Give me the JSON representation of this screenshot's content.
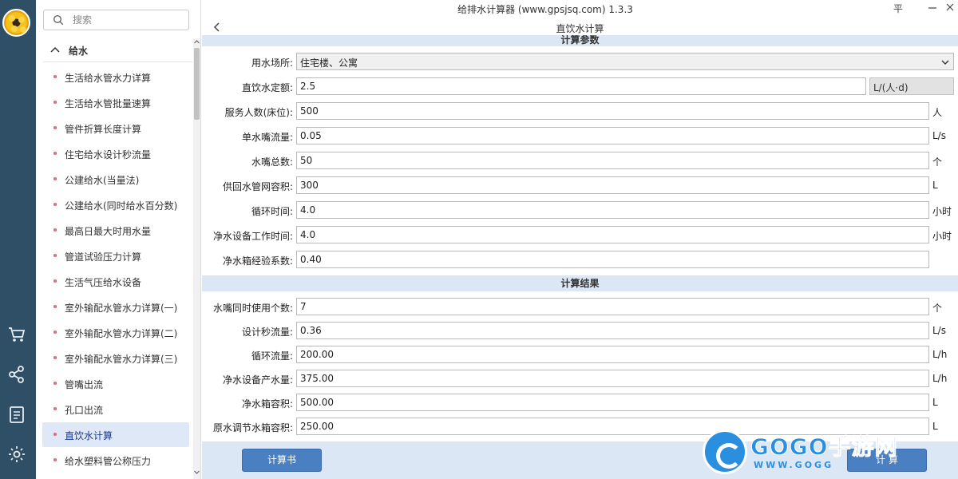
{
  "window": {
    "title": "给排水计算器 (www.gpsjsq.com) 1.3.3",
    "pin_glyph": "平"
  },
  "sidebar": {
    "search_placeholder": "搜索",
    "group_label": "给水",
    "items": [
      {
        "label": "生活给水管水力详算"
      },
      {
        "label": "生活给水管批量速算"
      },
      {
        "label": "管件折算长度计算"
      },
      {
        "label": "住宅给水设计秒流量"
      },
      {
        "label": "公建给水(当量法)"
      },
      {
        "label": "公建给水(同时给水百分数)"
      },
      {
        "label": "最高日最大时用水量"
      },
      {
        "label": "管道试验压力计算"
      },
      {
        "label": "生活气压给水设备"
      },
      {
        "label": "室外输配水管水力详算(一)"
      },
      {
        "label": "室外输配水管水力详算(二)"
      },
      {
        "label": "室外输配水管水力详算(三)"
      },
      {
        "label": "管嘴出流"
      },
      {
        "label": "孔口出流"
      },
      {
        "label": "直饮水计算"
      },
      {
        "label": "给水塑料管公称压力"
      }
    ],
    "active_index": 14
  },
  "rail_icons": [
    "cart-icon",
    "share-icon",
    "clipboard-icon",
    "settings-icon"
  ],
  "page": {
    "title": "直饮水计算"
  },
  "params": {
    "header": "计算参数",
    "fields": [
      {
        "label": "用水场所:",
        "value": "住宅楼、公寓",
        "unit": "",
        "type": "select"
      },
      {
        "label": "直饮水定额:",
        "value": "2.5",
        "unit": "L/(人·d)",
        "type": "unitbox"
      },
      {
        "label": "服务人数(床位):",
        "value": "500",
        "unit": "人"
      },
      {
        "label": "单水嘴流量:",
        "value": "0.05",
        "unit": "L/s"
      },
      {
        "label": "水嘴总数:",
        "value": "50",
        "unit": "个"
      },
      {
        "label": "供回水管网容积:",
        "value": "300",
        "unit": "L"
      },
      {
        "label": "循环时间:",
        "value": "4.0",
        "unit": "小时"
      },
      {
        "label": "净水设备工作时间:",
        "value": "4.0",
        "unit": "小时"
      },
      {
        "label": "净水箱经验系数:",
        "value": "0.40",
        "unit": ""
      }
    ]
  },
  "results": {
    "header": "计算结果",
    "fields": [
      {
        "label": "水嘴同时使用个数:",
        "value": "7",
        "unit": "个"
      },
      {
        "label": "设计秒流量:",
        "value": "0.36",
        "unit": "L/s"
      },
      {
        "label": "循环流量:",
        "value": "200.00",
        "unit": "L/h"
      },
      {
        "label": "净水设备产水量:",
        "value": "375.00",
        "unit": "L/h"
      },
      {
        "label": "净水箱容积:",
        "value": "500.00",
        "unit": "L"
      },
      {
        "label": "原水调节水箱容积:",
        "value": "250.00",
        "unit": "L"
      }
    ]
  },
  "buttons": {
    "report": "计算书",
    "calc": "计 算"
  },
  "watermark": {
    "brand": "GOGO手游网",
    "url": "WWW.GOGG"
  },
  "colors": {
    "rail": "#2f4f66",
    "section": "#dce7f5",
    "button": "#4a7fc2",
    "active_item": "#dfe8f6"
  }
}
